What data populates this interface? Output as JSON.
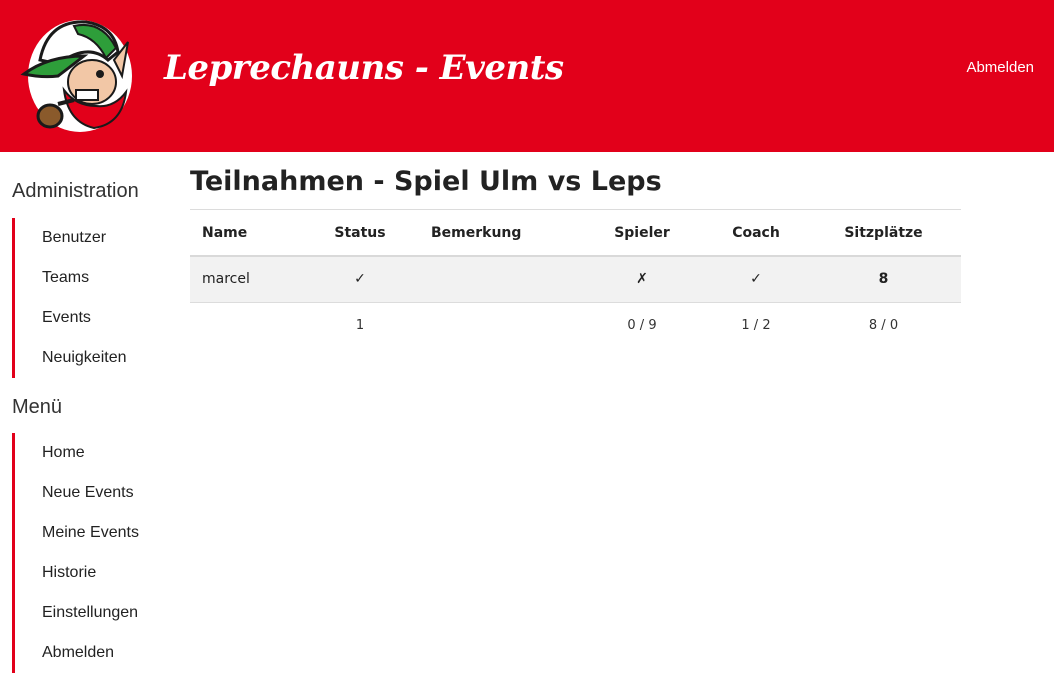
{
  "header": {
    "brand": "Leprechauns - Events",
    "logout_label": "Abmelden",
    "background_color": "#e2001a"
  },
  "sidebar": {
    "admin_title": "Administration",
    "admin_items": [
      "Benutzer",
      "Teams",
      "Events",
      "Neuigkeiten"
    ],
    "menu_title": "Menü",
    "menu_items": [
      "Home",
      "Neue Events",
      "Meine Events",
      "Historie",
      "Einstellungen",
      "Abmelden"
    ],
    "accent_color": "#e2001a"
  },
  "main": {
    "title": "Teilnahmen - Spiel Ulm vs Leps",
    "table": {
      "headers": [
        "Name",
        "Status",
        "Bemerkung",
        "Spieler",
        "Coach",
        "Sitzplätze"
      ],
      "rows": [
        [
          "marcel",
          "✓",
          "",
          "✗",
          "✓",
          "8"
        ]
      ],
      "summary": [
        "",
        "1",
        "",
        "0 / 9",
        "1 / 2",
        "8 / 0"
      ]
    }
  }
}
